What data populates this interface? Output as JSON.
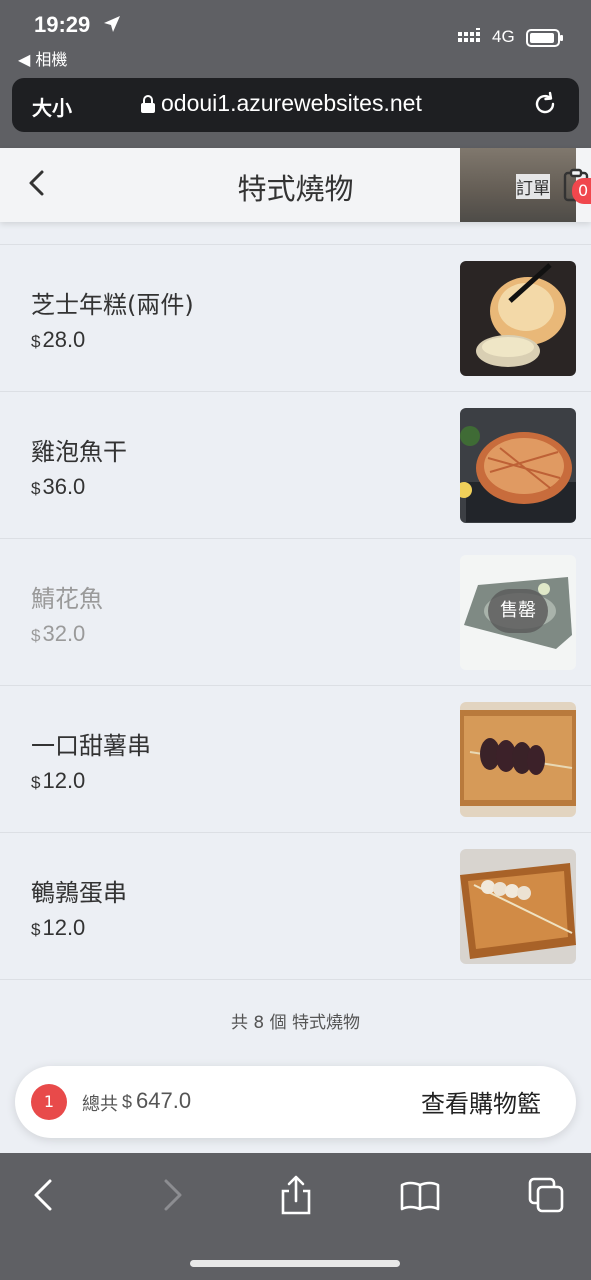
{
  "status_bar": {
    "time": "19:29",
    "back_app": "◀ 相機",
    "network": "4G"
  },
  "browser": {
    "text_size": "大小",
    "url": "odoui1.azurewebsites.net"
  },
  "header": {
    "title": "特式燒物",
    "order_label": "訂單",
    "order_count": "0"
  },
  "items": [
    {
      "name": "芝士年糕(兩件)",
      "currency": "$",
      "price": "28.0",
      "sold_out": false
    },
    {
      "name": "雞泡魚干",
      "currency": "$",
      "price": "36.0",
      "sold_out": false
    },
    {
      "name": "鯖花魚",
      "currency": "$",
      "price": "32.0",
      "sold_out": true,
      "sold_label": "售罄"
    },
    {
      "name": "一口甜薯串",
      "currency": "$",
      "price": "12.0",
      "sold_out": false
    },
    {
      "name": "鵪鶉蛋串",
      "currency": "$",
      "price": "12.0",
      "sold_out": false
    }
  ],
  "count_text": "共 8 個 特式燒物",
  "cart": {
    "count": "1",
    "total_label": "總共",
    "currency": "$",
    "total": "647.0",
    "view_label": "查看購物籃"
  },
  "colors": {
    "accent_red": "#e84a4a",
    "browser_chrome": "#5f6064",
    "page_bg": "#eceff4"
  }
}
